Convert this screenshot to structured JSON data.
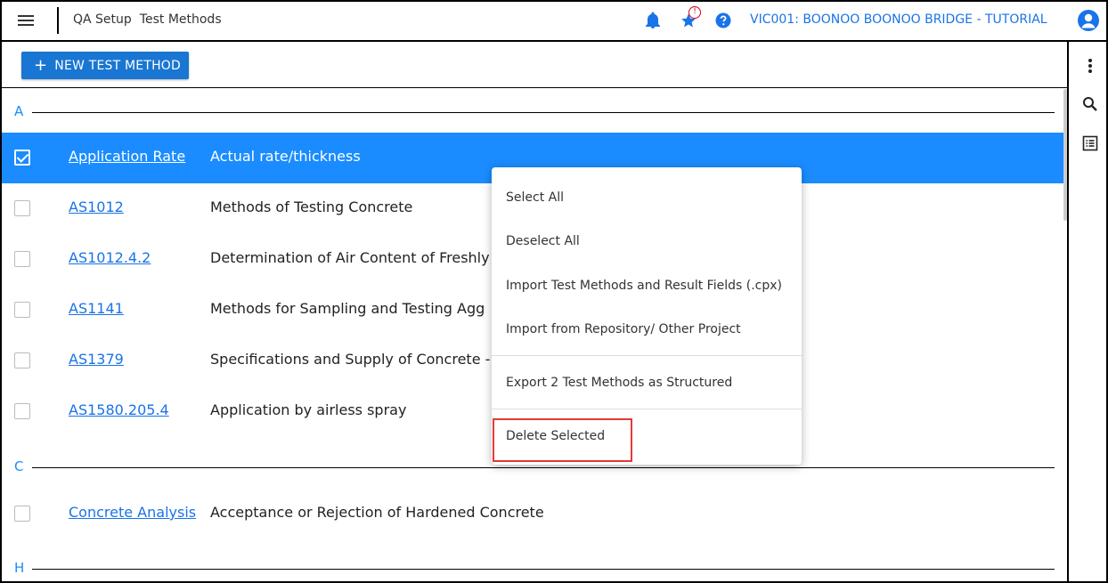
{
  "header": {
    "breadcrumb": [
      "QA Setup",
      "Test Methods"
    ],
    "project_title": "VIC001: BOONOO BOONOO BRIDGE - TUTORIAL",
    "star_badge": "!"
  },
  "toolbar": {
    "new_button_plus": "+",
    "new_button_label": "NEW TEST METHOD"
  },
  "sections": [
    {
      "letter": "A",
      "rows": [
        {
          "code": "Application Rate",
          "description": "Actual rate/thickness",
          "selected": true
        },
        {
          "code": "AS1012",
          "description": "Methods of Testing Concrete",
          "selected": false
        },
        {
          "code": "AS1012.4.2",
          "description": "Determination of Air Content of Freshly",
          "selected": false
        },
        {
          "code": "AS1141",
          "description": "Methods for Sampling and Testing Agg",
          "selected": false
        },
        {
          "code": "AS1379",
          "description": "Specifications and Supply of Concrete -",
          "selected": false
        },
        {
          "code": "AS1580.205.4",
          "description": "Application by airless spray",
          "selected": false
        }
      ]
    },
    {
      "letter": "C",
      "rows": [
        {
          "code": "Concrete Analysis",
          "description": "Acceptance or Rejection of Hardened Concrete",
          "selected": false
        }
      ]
    },
    {
      "letter": "H",
      "rows": []
    }
  ],
  "context_menu": {
    "items": [
      "Select All",
      "Deselect All",
      "Import Test Methods and Result Fields (.cpx)",
      "Import from Repository/ Other Project",
      "Export 2 Test Methods as Structured",
      "Delete Selected"
    ],
    "highlighted": "Delete Selected"
  },
  "colors": {
    "accent": "#1a8cff",
    "primary_button": "#1976d2",
    "link": "#1a73e8",
    "highlight_border": "#e53935",
    "badge": "#d0021b"
  },
  "icons": [
    "menu-icon",
    "bell-icon",
    "star-icon",
    "help-icon",
    "avatar-icon",
    "more-vert-icon",
    "search-icon",
    "list-view-icon"
  ]
}
